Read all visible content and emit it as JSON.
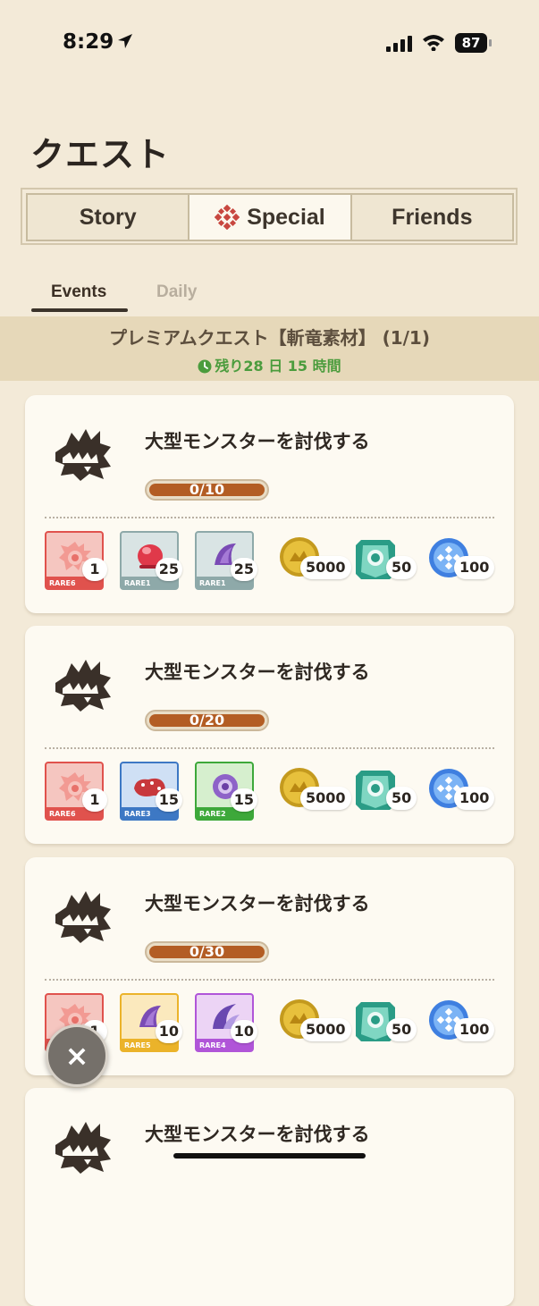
{
  "status_bar": {
    "time": "8:29",
    "battery": "87"
  },
  "page": {
    "title": "クエスト"
  },
  "tabs": [
    {
      "label": "Story"
    },
    {
      "label": "Special",
      "active": true
    },
    {
      "label": "Friends"
    }
  ],
  "subtabs": [
    {
      "label": "Events",
      "active": true
    },
    {
      "label": "Daily"
    }
  ],
  "banner": {
    "title": "プレミアムクエスト【斬竜素材】 (1/1)",
    "time_left": "残り28 日 15 時間"
  },
  "quests": [
    {
      "title": "大型モンスターを討伐する",
      "progress": "0/10",
      "progress_fraction": 0,
      "rewards": [
        {
          "rarity": "RARE6",
          "count": "1",
          "icon": "red-spiral-material-icon"
        },
        {
          "rarity": "RARE1",
          "count": "25",
          "icon": "red-stone-material-icon"
        },
        {
          "rarity": "RARE1",
          "count": "25",
          "icon": "purple-claw-material-icon"
        }
      ],
      "resources": [
        {
          "icon": "gold-coin-icon",
          "count": "5000"
        },
        {
          "icon": "green-crest-icon",
          "count": "50"
        },
        {
          "icon": "blue-orb-icon",
          "count": "100"
        }
      ]
    },
    {
      "title": "大型モンスターを討伐する",
      "progress": "0/20",
      "progress_fraction": 0,
      "rewards": [
        {
          "rarity": "RARE6",
          "count": "1",
          "icon": "red-spiral-material-icon"
        },
        {
          "rarity": "RARE3",
          "count": "15",
          "icon": "red-lump-material-icon"
        },
        {
          "rarity": "RARE2",
          "count": "15",
          "icon": "purple-orb-material-icon"
        }
      ],
      "resources": [
        {
          "icon": "gold-coin-icon",
          "count": "5000"
        },
        {
          "icon": "green-crest-icon",
          "count": "50"
        },
        {
          "icon": "blue-orb-icon",
          "count": "100"
        }
      ]
    },
    {
      "title": "大型モンスターを討伐する",
      "progress": "0/30",
      "progress_fraction": 0,
      "rewards": [
        {
          "rarity": "RARE6",
          "count": "1",
          "icon": "red-spiral-material-icon"
        },
        {
          "rarity": "RARE5",
          "count": "10",
          "icon": "purple-claw-material-icon"
        },
        {
          "rarity": "RARE4",
          "count": "10",
          "icon": "purple-horn-material-icon"
        }
      ],
      "resources": [
        {
          "icon": "gold-coin-icon",
          "count": "5000"
        },
        {
          "icon": "green-crest-icon",
          "count": "50"
        },
        {
          "icon": "blue-orb-icon",
          "count": "100"
        }
      ]
    },
    {
      "title": "大型モンスターを討伐する"
    }
  ],
  "close_button": {
    "label": "×"
  },
  "colors": {
    "background": "#f3ead8",
    "progress_fill": "#b35d24",
    "timer_green": "#4b9c3d",
    "rare6": "#e0524d",
    "rare1": "#8ea9a9",
    "rare3": "#3d78c4",
    "rare2": "#3da83a",
    "rare5": "#ebb32a",
    "rare4": "#b055d8"
  }
}
